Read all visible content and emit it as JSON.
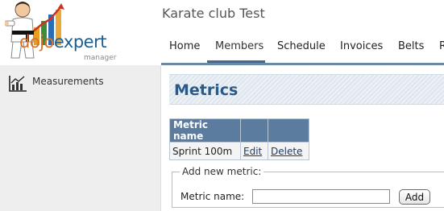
{
  "app": {
    "logo_dojo": "dojo",
    "logo_expert": "expert",
    "logo_sub": "manager",
    "club_title": "Karate club Test"
  },
  "nav": {
    "items": [
      {
        "label": "Home"
      },
      {
        "label": "Members",
        "active": true
      },
      {
        "label": "Schedule"
      },
      {
        "label": "Invoices"
      },
      {
        "label": "Belts"
      },
      {
        "label": "R"
      }
    ]
  },
  "sidebar": {
    "items": [
      {
        "label": "Measurements",
        "icon": "chart-icon"
      }
    ]
  },
  "main": {
    "title": "Metrics",
    "table": {
      "headers": [
        "Metric name",
        "",
        ""
      ],
      "rows": [
        {
          "name": "Sprint 100m",
          "edit": "Edit",
          "delete": "Delete"
        }
      ]
    },
    "add_form": {
      "legend": "Add new metric:",
      "label": "Metric name:",
      "value": "",
      "button": "Add"
    }
  },
  "colors": {
    "header_blue": "#5b7b9f",
    "title_blue": "#2b5a86",
    "logo_orange": "#d8742a",
    "logo_blue": "#1d5e8e"
  }
}
